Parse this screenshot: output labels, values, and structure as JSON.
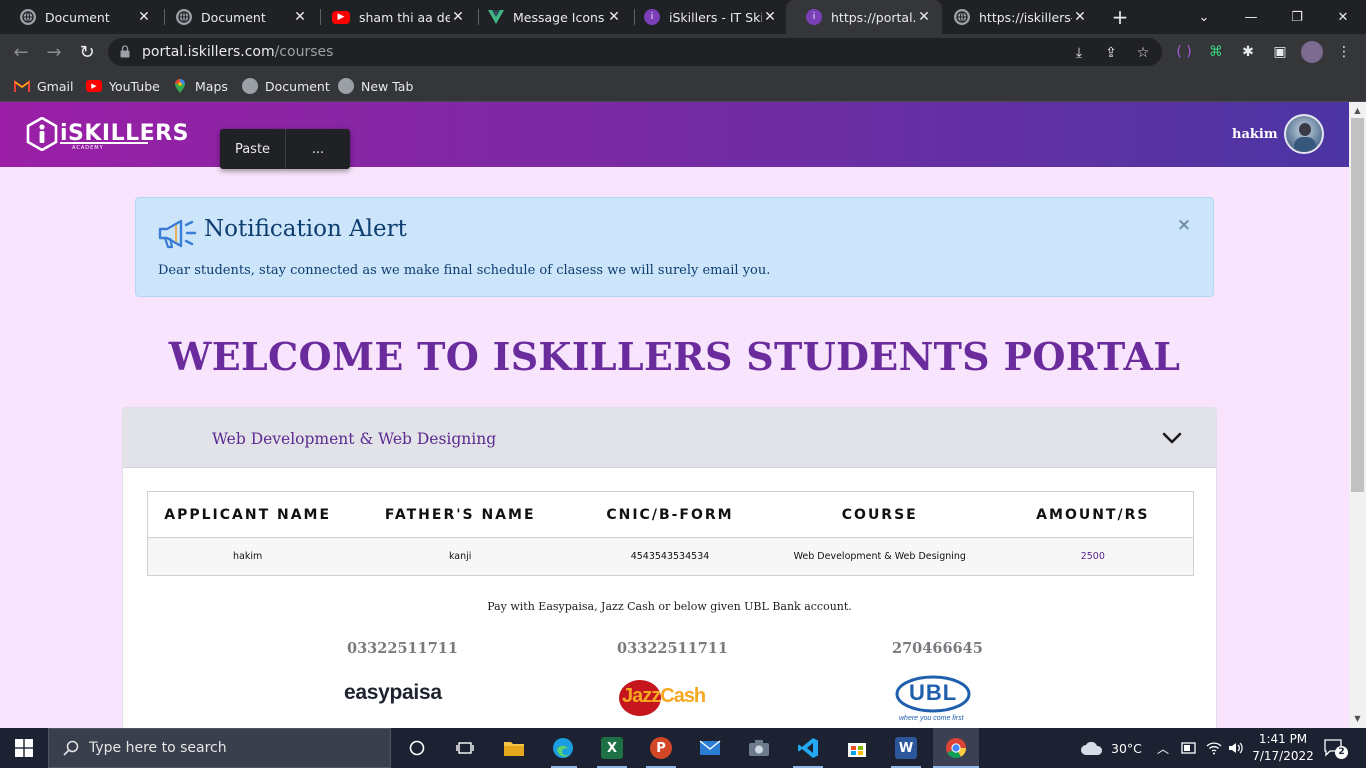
{
  "browser": {
    "tabs": [
      {
        "title": "Document",
        "icon": "globe-icon"
      },
      {
        "title": "Document",
        "icon": "globe-icon"
      },
      {
        "title": "sham thi aa deep",
        "icon": "youtube-icon"
      },
      {
        "title": "Message Icons &",
        "icon": "vue-icon"
      },
      {
        "title": "iSkillers - IT Skills",
        "icon": "iskillers-icon"
      },
      {
        "title": "https://portal.iski",
        "icon": "iskillers-icon"
      },
      {
        "title": "https://iskillers-p",
        "icon": "globe-icon"
      }
    ],
    "url_host": "portal.iskillers.com",
    "url_path": "/courses",
    "bookmarks": [
      {
        "label": "Gmail",
        "icon": "gmail-icon"
      },
      {
        "label": "YouTube",
        "icon": "youtube-icon"
      },
      {
        "label": "Maps",
        "icon": "maps-icon"
      },
      {
        "label": "Document",
        "icon": "globe-icon"
      },
      {
        "label": "New Tab",
        "icon": "globe-icon"
      }
    ]
  },
  "context_menu": {
    "paste": "Paste",
    "more": "..."
  },
  "header": {
    "logo_text": "iSKILLERS",
    "logo_sub": "ACADEMY",
    "user_name": "hakim"
  },
  "alert": {
    "title": "Notification Alert",
    "body": "Dear students, stay connected as we make final schedule of clasess we will surely email you.",
    "close": "×"
  },
  "welcome": "WELCOME TO ISKILLERS STUDENTS PORTAL",
  "course": {
    "title": "Web Development & Web Designing",
    "table": {
      "headers": [
        "APPLICANT NAME",
        "FATHER'S NAME",
        "CNIC/B-FORM",
        "COURSE",
        "AMOUNT/RS"
      ],
      "row": [
        "hakim",
        "kanji",
        "4543543534534",
        "Web Development & Web Designing",
        "2500"
      ]
    },
    "pay_note": "Pay with Easypaisa, Jazz Cash or below given UBL Bank account.",
    "payments": [
      {
        "number": "03322511711",
        "label": "easypaisa"
      },
      {
        "number": "03322511711",
        "label": "JazzCash"
      },
      {
        "number": "270466645",
        "label": "UBL",
        "tagline": "where you come first"
      }
    ]
  },
  "taskbar": {
    "search_placeholder": "Type here to search",
    "weather": "30°C",
    "time": "1:41 PM",
    "date": "7/17/2022",
    "notifications": "2"
  },
  "colors": {
    "header_start": "#9b1fa6",
    "header_end": "#4b35a3",
    "page_bg": "#f8e4fc",
    "accent_purple": "#6a2b9c",
    "alert_bg": "#cce5fb"
  }
}
